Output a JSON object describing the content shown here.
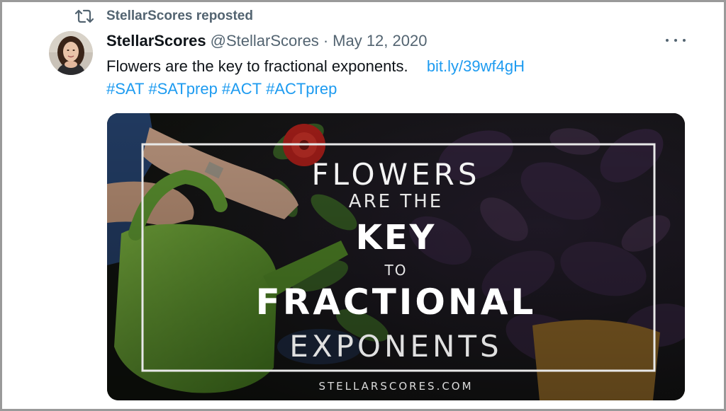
{
  "repost": {
    "label": "StellarScores reposted",
    "icon": "repost-icon"
  },
  "tweet": {
    "name": "StellarScores",
    "handle": "@StellarScores",
    "separator": "·",
    "date": "May 12, 2020",
    "text": "Flowers are the key to fractional exponents.",
    "link": "bit.ly/39wf4gH",
    "hashtags": [
      "#SAT",
      "#SATprep",
      "#ACT",
      "#ACTprep"
    ],
    "more_icon": "more-horizontal-icon"
  },
  "image": {
    "line1": "FLOWERS",
    "line2": "ARE THE",
    "line3": "KEY",
    "line4": "TO",
    "line5": "FRACTIONAL",
    "line6": "EXPONENTS",
    "footer": "STELLARSCORES.COM"
  },
  "colors": {
    "link": "#1d9bf0",
    "muted": "#536471",
    "text": "#0f1419"
  }
}
